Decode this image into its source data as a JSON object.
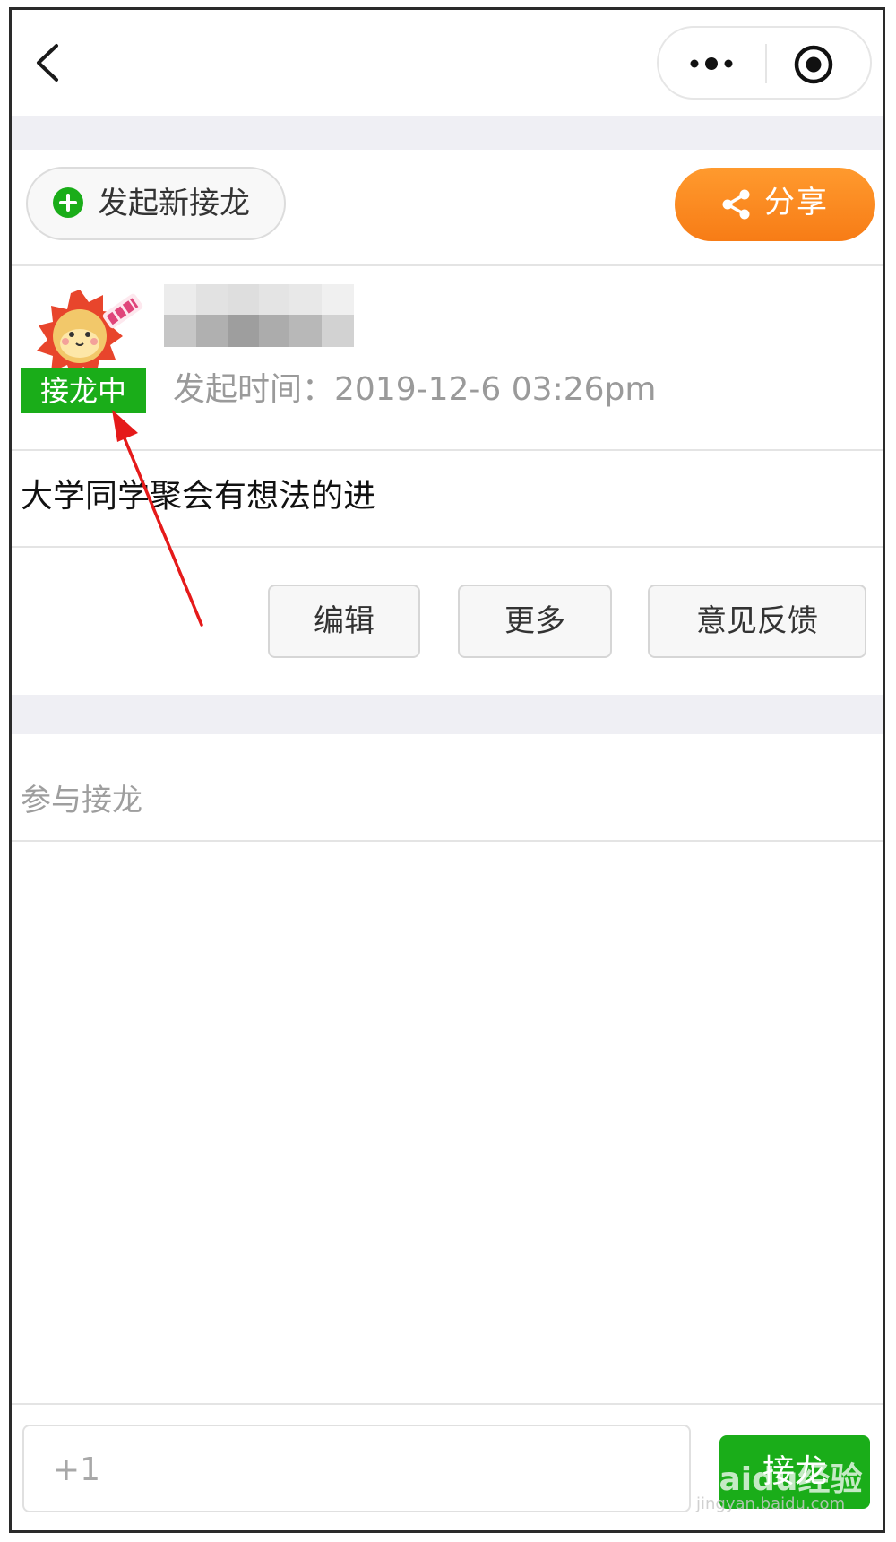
{
  "colors": {
    "accent_green": "#1aad19",
    "accent_orange": "#f77c16",
    "band_gray": "#efeff4"
  },
  "nav": {
    "back_icon": "chevron-left-icon",
    "more_icon": "more-dots-icon",
    "close_icon": "target-circle-icon"
  },
  "actions": {
    "new_label": "发起新接龙",
    "share_label": "分享"
  },
  "post": {
    "status": "接龙中",
    "time_label": "发起时间：",
    "time": "2019-12-6 03:26pm",
    "description": "大学同学聚会有想法的进"
  },
  "buttons": {
    "edit": "编辑",
    "more": "更多",
    "feedback": "意见反馈"
  },
  "participants": {
    "header": "参与接龙"
  },
  "bottom": {
    "input_placeholder": "+1",
    "submit": "接龙"
  },
  "watermark": {
    "brand": "Baidu经验",
    "url": "jingyan.baidu.com"
  }
}
